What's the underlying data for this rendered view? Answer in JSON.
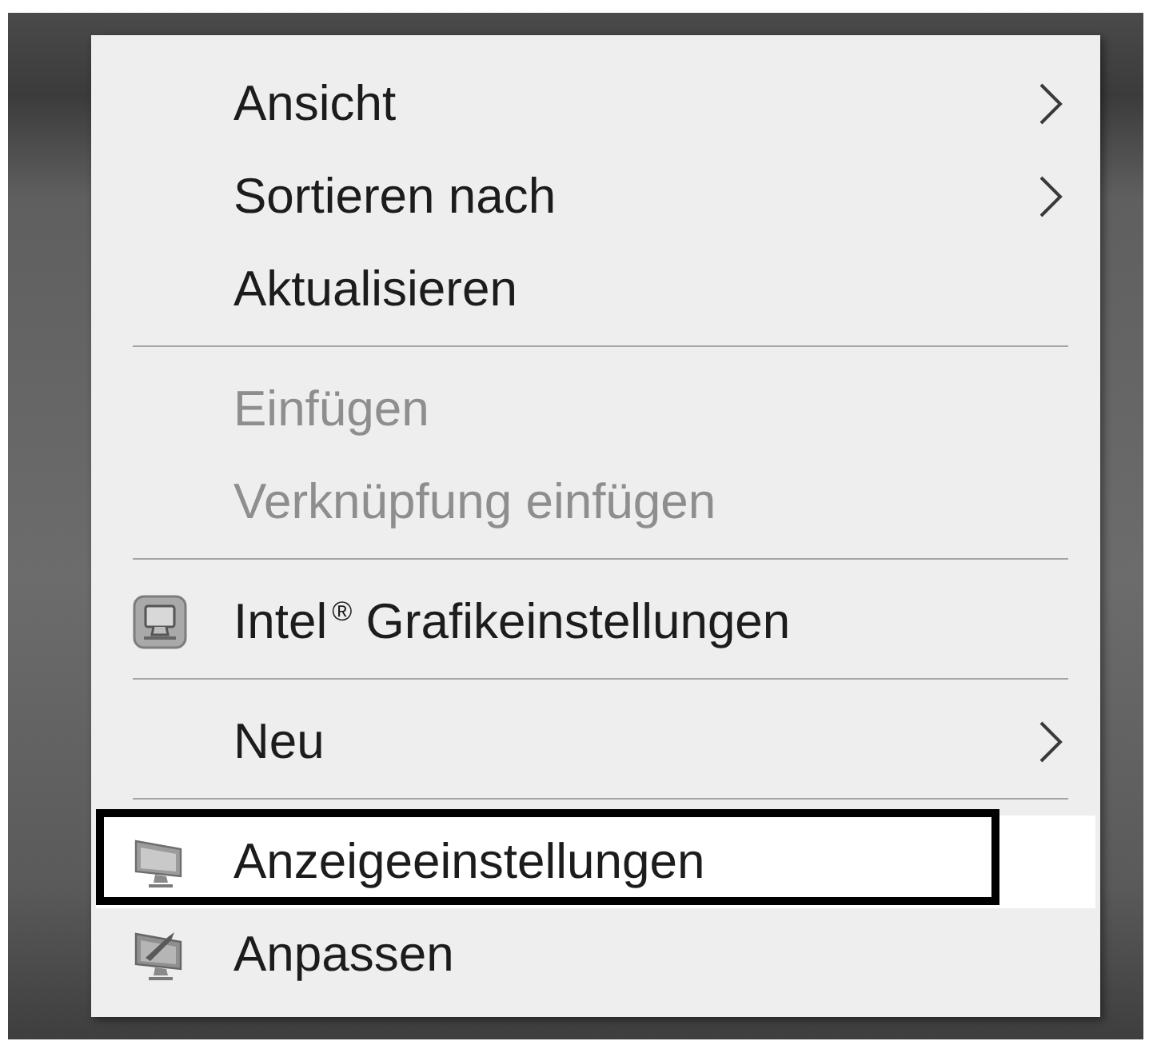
{
  "context_menu": {
    "items": [
      {
        "kind": "entry",
        "label": "Ansicht",
        "icon": false,
        "submenu": true,
        "disabled": false,
        "selected": false,
        "framed": false
      },
      {
        "kind": "entry",
        "label": "Sortieren nach",
        "icon": false,
        "submenu": true,
        "disabled": false,
        "selected": false,
        "framed": false
      },
      {
        "kind": "entry",
        "label": "Aktualisieren",
        "icon": false,
        "submenu": false,
        "disabled": false,
        "selected": false,
        "framed": false
      },
      {
        "kind": "separator"
      },
      {
        "kind": "entry",
        "label": "Einfügen",
        "icon": false,
        "submenu": false,
        "disabled": true,
        "selected": false,
        "framed": false
      },
      {
        "kind": "entry",
        "label": "Verknüpfung einfügen",
        "icon": false,
        "submenu": false,
        "disabled": true,
        "selected": false,
        "framed": false
      },
      {
        "kind": "separator"
      },
      {
        "kind": "entry",
        "label": "Intel$^{®}$ Grafikeinstellungen",
        "icon": true,
        "submenu": false,
        "disabled": false,
        "selected": false,
        "framed": false
      },
      {
        "kind": "separator"
      },
      {
        "kind": "entry",
        "label": "Neu",
        "icon": false,
        "submenu": true,
        "disabled": false,
        "selected": false,
        "framed": false
      },
      {
        "kind": "separator"
      },
      {
        "kind": "entry",
        "label": "Anzeigeeinstellungen",
        "icon": true,
        "submenu": false,
        "disabled": false,
        "selected": true,
        "framed": true
      },
      {
        "kind": "entry",
        "label": "Anpassen",
        "icon": true,
        "submenu": false,
        "disabled": false,
        "selected": false,
        "framed": false
      }
    ]
  }
}
